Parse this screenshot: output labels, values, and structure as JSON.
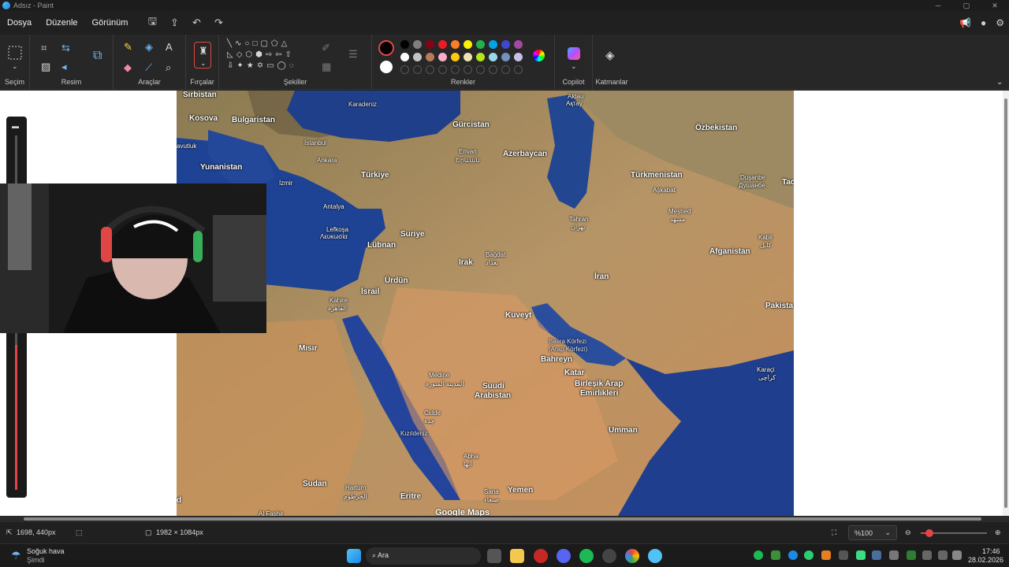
{
  "window": {
    "title": "Adsız - Paint"
  },
  "menu": {
    "items": [
      "Dosya",
      "Düzenle",
      "Görünüm"
    ]
  },
  "ribbon": {
    "groups": {
      "selection": "Seçim",
      "image": "Resim",
      "tools": "Araçlar",
      "brushes": "Fırçalar",
      "shapes": "Şekiller",
      "colors": "Renkler",
      "copilot": "Copilot",
      "layers": "Katmanlar"
    },
    "palette_row1": [
      "#000000",
      "#7f7f7f",
      "#880015",
      "#ed1c24",
      "#ff7f27",
      "#fff200",
      "#22b14c",
      "#00a2e8",
      "#3f48cc",
      "#a349a4"
    ],
    "palette_row2": [
      "#ffffff",
      "#c3c3c3",
      "#b97a57",
      "#ffaec9",
      "#ffc90e",
      "#efe4b0",
      "#b5e61d",
      "#99d9ea",
      "#7092be",
      "#c8bfe7"
    ],
    "primary_color": "#000000",
    "secondary_color": "#ffffff"
  },
  "map": {
    "labels": {
      "sirbistan": "Sırbistan",
      "kosova": "Kosova",
      "bulgaristan": "Bulgaristan",
      "avutluk": "avutluk",
      "istanbul": "İstanbul",
      "yunanistan": "Yunanistan",
      "ankara": "Ankara",
      "izmir": "İzmir",
      "turkiye": "Türkiye",
      "antalya": "Antalya",
      "karadeniz": "Karadeniz",
      "gurcistan": "Gürcistan",
      "erivan": "Erivan",
      "erivan_local": "Երևան",
      "azerbaycan": "Azerbaycan",
      "aktau": "Aktau",
      "aktau_local": "Ақтау",
      "ozbekistan": "Özbekistan",
      "turkmenistan": "Türkmenistan",
      "askabat": "Aşkabat",
      "dusanbe": "Duşanbe",
      "dusanbe_local": "Душанбе",
      "tac": "Tac",
      "meshed": "Meşhed",
      "meshed_local": "مشهد",
      "kabil": "Kabil",
      "kabil_local": "کابل",
      "tahran": "Tahran",
      "tahran_local": "تهران",
      "lefkosa": "Lefkoşa",
      "lefkosa_local": "Λευκωσία",
      "lubnan": "Lübnan",
      "suriye": "Suriye",
      "irak": "Irak",
      "bagdat": "Bağdat",
      "bagdat_local": "بغداد",
      "afganistan": "Afganistan",
      "iran": "İran",
      "urdun": "Ürdün",
      "israil": "İsrail",
      "kahire": "Kahire",
      "kahire_local": "القاهرة",
      "kuveyt": "Kuveyt",
      "pakista": "Pakista",
      "basra": "Basra Körfezi",
      "basra2": "(Arap Körfezi)",
      "misir": "Mısır",
      "bahreyn": "Bahreyn",
      "katar": "Katar",
      "karaci": "Karaçi",
      "karaci_local": "کراچی",
      "medine": "Medine",
      "medine_local": "المدينة المنورة",
      "suudi": "Suudi",
      "arabistan": "Arabistan",
      "bae": "Birleşik Arap",
      "bae2": "Emirlikleri",
      "cidde": "Cidde",
      "cidde_local": "جدة",
      "kizildeniz": "Kızıldeniz",
      "umman": "Umman",
      "abha": "Abha",
      "abha_local": "أبها",
      "sudan": "Sudan",
      "hartum": "Hartum",
      "hartum_local": "الخرطوم",
      "eritre": "Eritre",
      "sana": "Sana",
      "sana_local": "صنعاء",
      "yemen": "Yemen",
      "d": "d",
      "alfashir": "Al Fashir",
      "google": "Google Maps"
    }
  },
  "status": {
    "cursor_pos": "1698, 440px",
    "canvas_size": "1982 × 1084px",
    "zoom": "%100"
  },
  "taskbar": {
    "weather": "Soğuk hava",
    "weather_sub": "Şimdi",
    "search": "Ara",
    "time": "17:46",
    "date": "28.02.2026"
  }
}
